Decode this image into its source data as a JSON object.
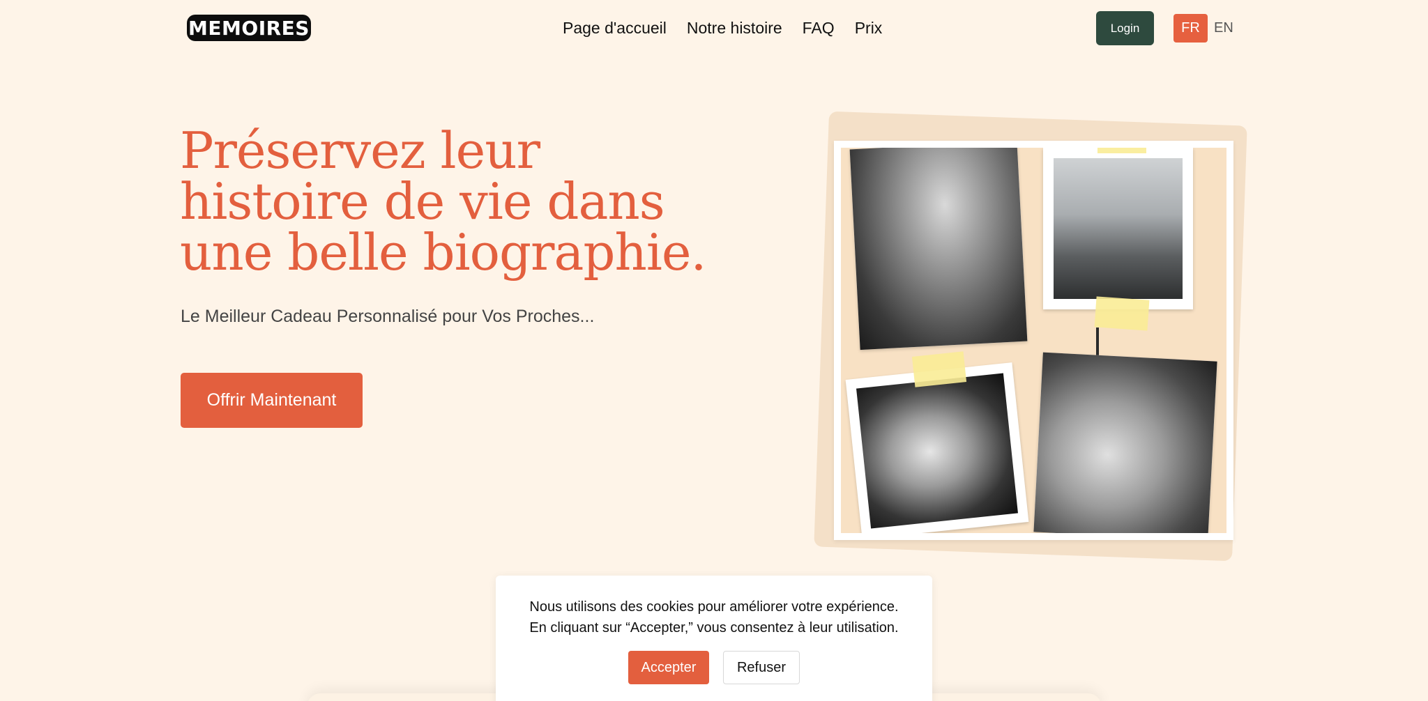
{
  "header": {
    "logo_text": "MEMOIRES",
    "nav": [
      {
        "label": "Page d'accueil"
      },
      {
        "label": "Notre histoire"
      },
      {
        "label": "FAQ"
      },
      {
        "label": "Prix"
      }
    ],
    "login_label": "Login",
    "languages": {
      "active": "FR",
      "other": "EN"
    }
  },
  "hero": {
    "title": "Préservez leur histoire de vie dans une belle biographie.",
    "subtitle": "Le Meilleur Cadeau Personnalisé pour Vos Proches...",
    "cta_label": "Offrir Maintenant"
  },
  "cookie_banner": {
    "text": "Nous utilisons des cookies pour améliorer votre expérience. En cliquant sur “Accepter,” vous consentez à leur utilisation.",
    "accept_label": "Accepter",
    "refuse_label": "Refuser"
  },
  "colors": {
    "background": "#fef4e8",
    "accent": "#e35f3e",
    "dark_green": "#2e4a3e"
  }
}
